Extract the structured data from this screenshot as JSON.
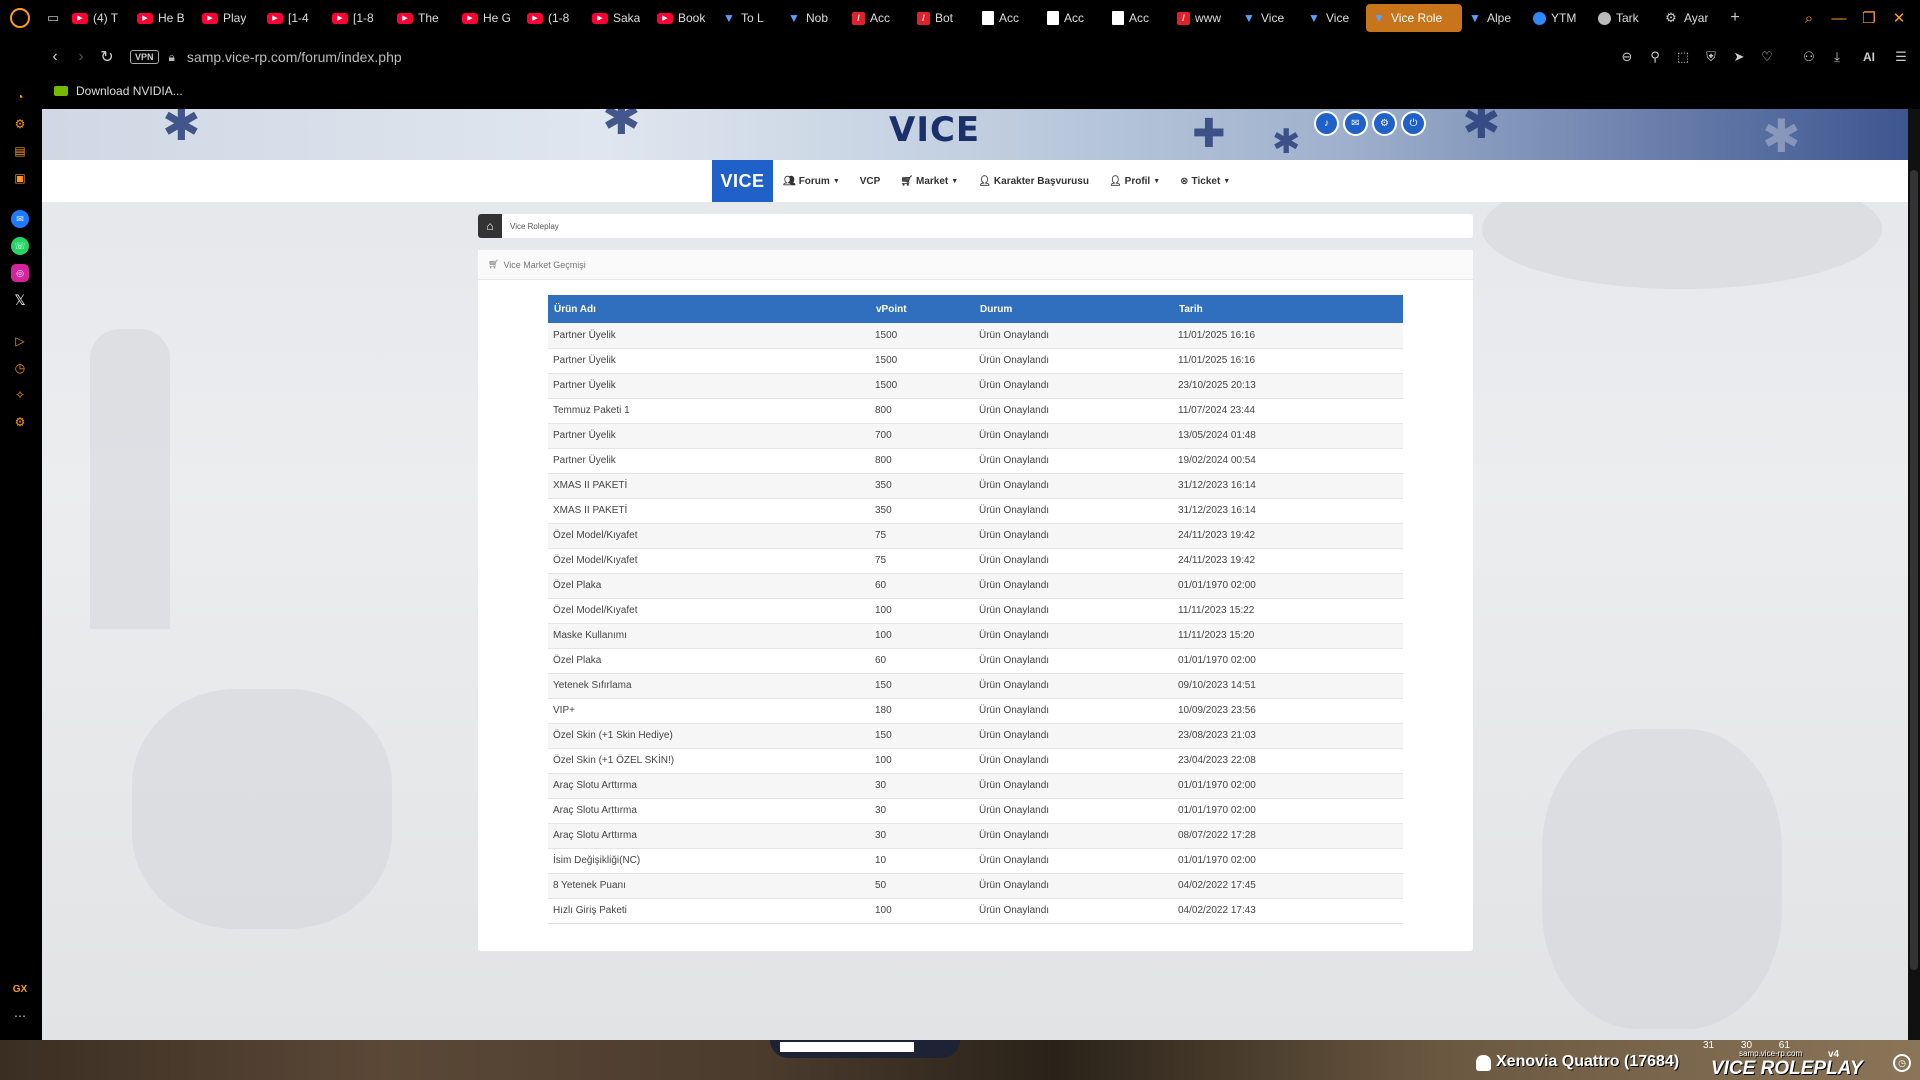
{
  "browser": {
    "tabs": [
      {
        "label": "(4) T",
        "fav": "yt"
      },
      {
        "label": "He B",
        "fav": "yt"
      },
      {
        "label": "Play",
        "fav": "yt"
      },
      {
        "label": "[1-4",
        "fav": "yt"
      },
      {
        "label": "[1-8",
        "fav": "yt"
      },
      {
        "label": "The",
        "fav": "yt"
      },
      {
        "label": "He G",
        "fav": "yt"
      },
      {
        "label": "(1-8",
        "fav": "yt"
      },
      {
        "label": "Saka",
        "fav": "yt"
      },
      {
        "label": "Book",
        "fav": "yt"
      },
      {
        "label": "To L",
        "fav": "vice"
      },
      {
        "label": "Nob",
        "fav": "vice"
      },
      {
        "label": "Acc",
        "fav": "adobe"
      },
      {
        "label": "Bot",
        "fav": "adobe"
      },
      {
        "label": "Acc",
        "fav": "doc"
      },
      {
        "label": "Acc",
        "fav": "doc"
      },
      {
        "label": "Acc",
        "fav": "doc"
      },
      {
        "label": "www",
        "fav": "adobe"
      },
      {
        "label": "Vice",
        "fav": "vice"
      },
      {
        "label": "Vice",
        "fav": "vice"
      },
      {
        "label": "Vice Role",
        "fav": "vice",
        "active": true
      },
      {
        "label": "Alpe",
        "fav": "vice"
      },
      {
        "label": "YTM",
        "fav": "blue"
      },
      {
        "label": "Tark",
        "fav": "round"
      },
      {
        "label": "Ayar",
        "fav": "gear"
      }
    ],
    "url": "samp.vice-rp.com/forum/index.php",
    "vpn_label": "VPN",
    "ai_label": "AI",
    "bookmark": "Download NVIDIA...",
    "sidebar_gx": "GX"
  },
  "site": {
    "brand": "VICE",
    "menu": [
      {
        "label": "Forum",
        "icon": "users-icon",
        "caret": true
      },
      {
        "label": "VCP",
        "icon": "",
        "caret": false
      },
      {
        "label": "Market",
        "icon": "cart-icon",
        "caret": true
      },
      {
        "label": "Karakter Başvurusu",
        "icon": "user-plus-icon",
        "caret": false
      },
      {
        "label": "Profil",
        "icon": "user-icon",
        "caret": true
      },
      {
        "label": "Ticket",
        "icon": "ticket-icon",
        "caret": true
      }
    ],
    "breadcrumb": "Vice Roleplay",
    "card_title": "Vice Market Geçmişi",
    "table": {
      "headers": [
        "Ürün Adı",
        "vPoint",
        "Durum",
        "Tarih"
      ],
      "rows": [
        [
          "Partner Üyelik",
          "1500",
          "Ürün Onaylandı",
          "11/01/2025 16:16"
        ],
        [
          "Partner Üyelik",
          "1500",
          "Ürün Onaylandı",
          "11/01/2025 16:16"
        ],
        [
          "Partner Üyelik",
          "1500",
          "Ürün Onaylandı",
          "23/10/2025 20:13"
        ],
        [
          "Temmuz Paketi 1",
          "800",
          "Ürün Onaylandı",
          "11/07/2024 23:44"
        ],
        [
          "Partner Üyelik",
          "700",
          "Ürün Onaylandı",
          "13/05/2024 01:48"
        ],
        [
          "Partner Üyelik",
          "800",
          "Ürün Onaylandı",
          "19/02/2024 00:54"
        ],
        [
          "XMAS II PAKETİ",
          "350",
          "Ürün Onaylandı",
          "31/12/2023 16:14"
        ],
        [
          "XMAS II PAKETİ",
          "350",
          "Ürün Onaylandı",
          "31/12/2023 16:14"
        ],
        [
          "Özel Model/Kıyafet",
          "75",
          "Ürün Onaylandı",
          "24/11/2023 19:42"
        ],
        [
          "Özel Model/Kıyafet",
          "75",
          "Ürün Onaylandı",
          "24/11/2023 19:42"
        ],
        [
          "Özel Plaka",
          "60",
          "Ürün Onaylandı",
          "01/01/1970 02:00"
        ],
        [
          "Özel Model/Kıyafet",
          "100",
          "Ürün Onaylandı",
          "11/11/2023 15:22"
        ],
        [
          "Maske Kullanımı",
          "100",
          "Ürün Onaylandı",
          "11/11/2023 15:20"
        ],
        [
          "Özel Plaka",
          "60",
          "Ürün Onaylandı",
          "01/01/1970 02:00"
        ],
        [
          "Yetenek Sıfırlama",
          "150",
          "Ürün Onaylandı",
          "09/10/2023 14:51"
        ],
        [
          "VIP+",
          "180",
          "Ürün Onaylandı",
          "10/09/2023 23:56"
        ],
        [
          "Özel Skin (+1 Skin Hediye)",
          "150",
          "Ürün Onaylandı",
          "23/08/2023 21:03"
        ],
        [
          "Özel Skin (+1 ÖZEL SKİN!)",
          "100",
          "Ürün Onaylandı",
          "23/04/2023 22:08"
        ],
        [
          "Araç Slotu Arttırma",
          "30",
          "Ürün Onaylandı",
          "01/01/1970 02:00"
        ],
        [
          "Araç Slotu Arttırma",
          "30",
          "Ürün Onaylandı",
          "01/01/1970 02:00"
        ],
        [
          "Araç Slotu Arttırma",
          "30",
          "Ürün Onaylandı",
          "08/07/2022 17:28"
        ],
        [
          "İsim Değişikliği(NC)",
          "10",
          "Ürün Onaylandı",
          "01/01/1970 02:00"
        ],
        [
          "8 Yetenek Puanı",
          "50",
          "Ürün Onaylandı",
          "04/02/2022 17:45"
        ],
        [
          "Hızlı Giriş Paketi",
          "100",
          "Ürün Onaylandı",
          "04/02/2022 17:43"
        ]
      ]
    },
    "accent_color": "#1f61c8",
    "header_color": "#2f6fbd"
  },
  "game_hud": {
    "player": "Xenovia Quattro (17684)",
    "server_url": "samp.vice-rp.com",
    "server_logo": "VICE ROLEPLAY",
    "version": "v4",
    "stats": "31 30 61"
  }
}
